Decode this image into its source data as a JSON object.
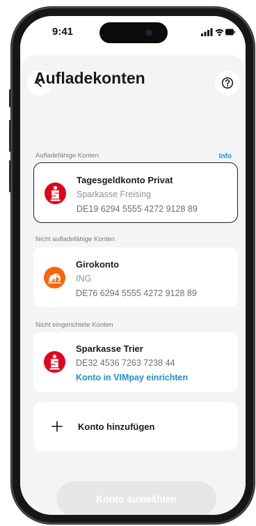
{
  "status_bar": {
    "time": "9:41"
  },
  "nav": {
    "back_icon": "chevron-left-icon",
    "help_icon": "question-mark-circle-icon"
  },
  "page": {
    "title": "Aufladekonten"
  },
  "sections": {
    "chargeable": {
      "label": "Aufladefähige Konten",
      "info_link": "Info"
    },
    "non_chargeable": {
      "label": "Nicht aufladefähige Konten"
    },
    "not_setup": {
      "label": "Nicht eingerichtete Konten"
    }
  },
  "accounts": {
    "tagesgeld": {
      "name": "Tagesgeldkonto Privat",
      "bank": "Sparkasse Freising",
      "iban": "DE19 6294 5555 4272 9128 89",
      "logo": "sparkasse-logo-icon",
      "selected": true
    },
    "giro": {
      "name": "Girokonto",
      "bank": "ING",
      "iban": "DE76 6294 5555 4272 9128 89",
      "logo": "ing-lion-logo-icon"
    },
    "trier": {
      "name": "Sparkasse Trier",
      "iban": "DE32 4536 7263 7238 44",
      "setup_link": "Konto in VIMpay einrichten",
      "logo": "sparkasse-logo-icon"
    }
  },
  "add_account": {
    "label": "Konto hinzufügen",
    "icon": "plus-icon"
  },
  "cta": {
    "label": "Konto auswählen",
    "enabled": false
  },
  "colors": {
    "sparkasse_red": "#e2001a",
    "ing_orange": "#ff6200",
    "link_blue": "#1f8fd6",
    "background": "#f3f4f5",
    "cta_disabled": "#e6e7e9"
  }
}
